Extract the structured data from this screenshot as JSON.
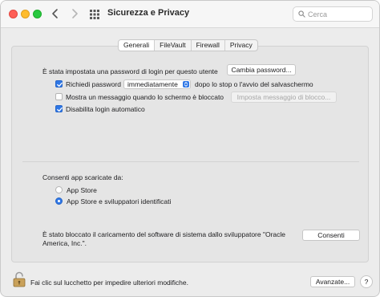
{
  "window": {
    "title": "Sicurezza e Privacy",
    "search_placeholder": "Cerca"
  },
  "tabs": [
    {
      "label": "Generali",
      "active": true
    },
    {
      "label": "FileVault",
      "active": false
    },
    {
      "label": "Firewall",
      "active": false
    },
    {
      "label": "Privacy",
      "active": false
    }
  ],
  "general": {
    "password_set_text": "È stata impostata una password di login per questo utente",
    "change_password_button": "Cambia password...",
    "require_password": {
      "label": "Richiedi password",
      "checked": true
    },
    "require_password_select": "immediatamente",
    "require_password_suffix": "dopo lo stop o l'avvio del salvaschermo",
    "show_message": {
      "label": "Mostra un messaggio quando lo schermo è bloccato",
      "checked": false
    },
    "set_lock_message_button": "Imposta messaggio di blocco...",
    "disable_auto_login": {
      "label": "Disabilita login automatico",
      "checked": true
    },
    "allow_apps_label": "Consenti app scaricate da:",
    "app_store_option": {
      "label": "App Store",
      "selected": false
    },
    "app_store_dev_option": {
      "label": "App Store e sviluppatori identificati",
      "selected": true
    },
    "blocked_text_line1": "È stato bloccato il caricamento del software di sistema dallo sviluppatore \"Oracle",
    "blocked_text_line2": "America, Inc.\".",
    "allow_button": "Consenti"
  },
  "footer": {
    "lock_text": "Fai clic sul lucchetto per impedire ulteriori modifiche.",
    "advanced_button": "Avanzate...",
    "help_button": "?"
  },
  "colors": {
    "accent": "#2f77e6",
    "close": "#fe5f57",
    "minimize": "#febc2e",
    "zoom": "#28c840"
  }
}
